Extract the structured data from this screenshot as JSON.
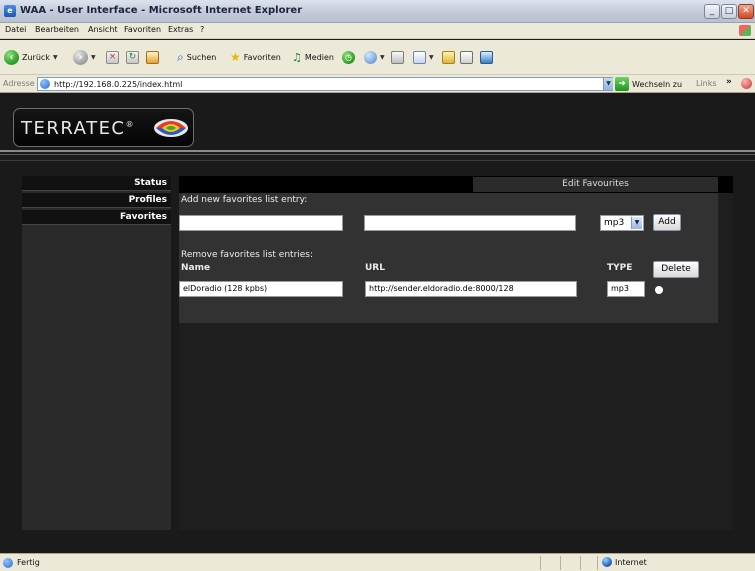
{
  "window": {
    "title": "WAA - User Interface - Microsoft Internet Explorer",
    "min": "_",
    "max": "□",
    "close": "✕"
  },
  "menu": [
    "Datei",
    "Bearbeiten",
    "Ansicht",
    "Favoriten",
    "Extras",
    "?"
  ],
  "toolbar": {
    "back": "Zurück",
    "search": "Suchen",
    "favorites": "Favoriten",
    "media": "Medien"
  },
  "address": {
    "label": "Adresse",
    "url": "http://192.168.0.225/index.html",
    "go": "Wechseln zu",
    "links": "Links"
  },
  "brand": {
    "name": "TERRATEC",
    "registered": "®"
  },
  "nav": [
    "Status",
    "Profiles",
    "Favorites"
  ],
  "panel": {
    "header": "Edit Favourites",
    "add_title": "Add new favorites list entry:",
    "add_name_value": "",
    "add_url_value": "",
    "add_type": "mp3",
    "add_button": "Add",
    "remove_title": "Remove favorites list entries:",
    "col_name": "Name",
    "col_url": "URL",
    "col_type": "TYPE",
    "delete_button": "Delete",
    "entries": [
      {
        "name": "elDoradio (128 kpbs)",
        "url": "http://sender.eldoradio.de:8000/128",
        "type": "mp3"
      }
    ]
  },
  "status": {
    "text": "Fertig",
    "zone": "Internet"
  },
  "colors": {
    "background": "#1a1a1a",
    "panel": "#323232",
    "header": "#000000",
    "tab": "#2b2b2b"
  }
}
